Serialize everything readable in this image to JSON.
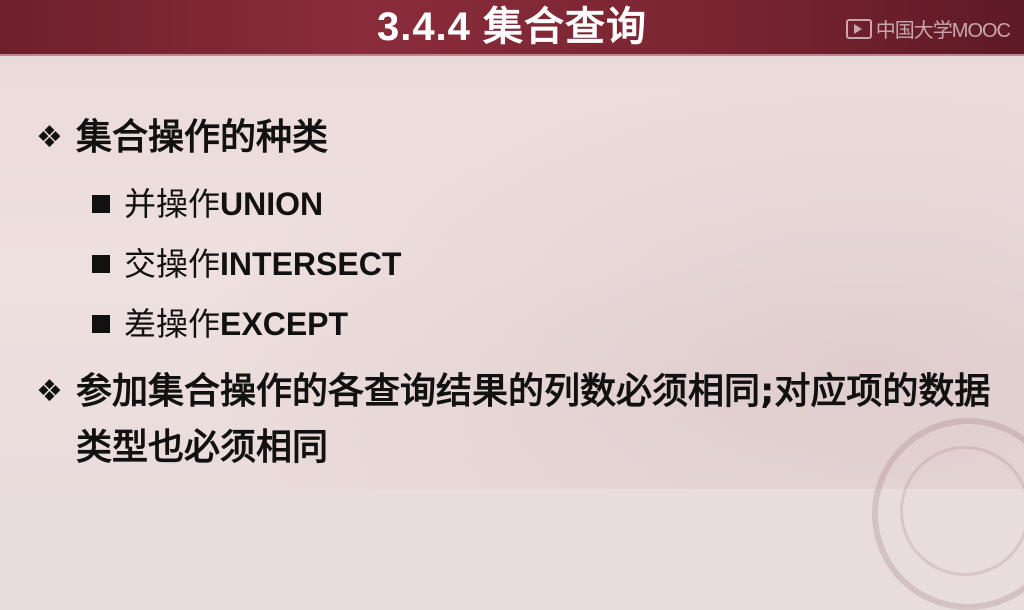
{
  "slide": {
    "title": "3.4.4 集合查询",
    "watermark": "中国大学MOOC"
  },
  "bullets": [
    {
      "marker": "❖",
      "text": "集合操作的种类",
      "sub": [
        {
          "cn": "并操作",
          "en": "UNION"
        },
        {
          "cn": "交操作",
          "en": "INTERSECT"
        },
        {
          "cn": "差操作",
          "en": "EXCEPT"
        }
      ]
    },
    {
      "marker": "❖",
      "text": "参加集合操作的各查询结果的列数必须相同;对应项的数据类型也必须相同"
    }
  ]
}
